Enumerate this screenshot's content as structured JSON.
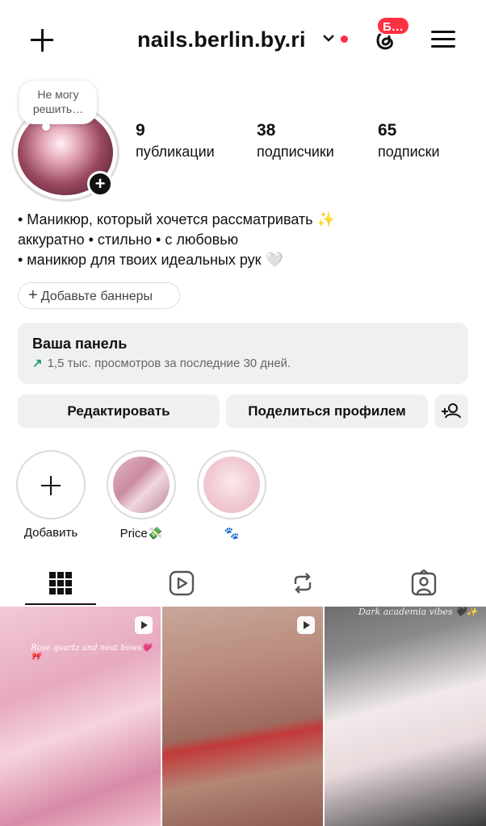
{
  "header": {
    "username": "nails.berlin.by.ri",
    "notification_badge": "Б…",
    "accent_color": "#ff3040"
  },
  "profile": {
    "note": "Не могу решить…",
    "stats": [
      {
        "value": "9",
        "label": "публикации"
      },
      {
        "value": "38",
        "label": "подписчики"
      },
      {
        "value": "65",
        "label": "подписки"
      }
    ],
    "bio": [
      "• Маникюр, который хочется рассматривать ✨",
      "аккуратно • стильно • с любовью",
      "• маникюр для твоих идеальных рук 🤍"
    ],
    "banner_button": "Добавьте баннеры"
  },
  "dashboard": {
    "title": "Ваша панель",
    "subtitle": "1,5 тыс. просмотров за последние 30 дней."
  },
  "actions": {
    "edit": "Редактировать",
    "share": "Поделиться профилем"
  },
  "highlights": [
    {
      "label": "Добавить"
    },
    {
      "label": "Price💸"
    },
    {
      "label": "🐾"
    }
  ],
  "tabs": [
    "grid-icon",
    "reels-icon",
    "reposts-icon",
    "tagged-icon"
  ],
  "posts": [
    {
      "caption": "Rose quartz and neat bows💗🎀"
    },
    {
      "caption": ""
    },
    {
      "caption": "Dark academia vibes 🖤✨"
    }
  ]
}
